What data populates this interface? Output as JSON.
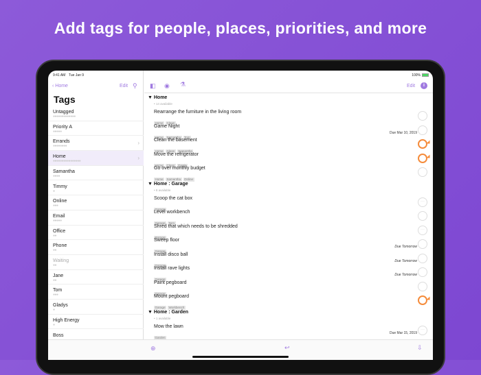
{
  "headline": "Add tags for people, places, priorities, and more",
  "status": {
    "time": "9:41 AM",
    "date": "Tue Jan 9",
    "battery": "100%"
  },
  "sidebar": {
    "back": "Home",
    "edit": "Edit",
    "title": "Tags",
    "items": [
      {
        "label": "Untagged",
        "dots": "●●●●●●●●●●●●●",
        "chev": false
      },
      {
        "label": "Priority A",
        "dots": "●●●●●",
        "chev": false
      },
      {
        "label": "Errands",
        "dots": "●●●●●●●●",
        "chev": true
      },
      {
        "label": "Home",
        "dots": "●●●●●●●●●●●●●●●●",
        "chev": true,
        "selected": true
      },
      {
        "label": "Samantha",
        "dots": "●●●●",
        "chev": false
      },
      {
        "label": "Timmy",
        "dots": "●",
        "chev": false
      },
      {
        "label": "Online",
        "dots": "●●●",
        "chev": false
      },
      {
        "label": "Email",
        "dots": "●●●●●",
        "chev": false
      },
      {
        "label": "Office",
        "dots": "●●",
        "chev": false
      },
      {
        "label": "Phone",
        "dots": "●●",
        "chev": false
      },
      {
        "label": "Waiting",
        "dots": "●●",
        "chev": false,
        "muted": true
      },
      {
        "label": "Jane",
        "dots": "●●",
        "chev": false
      },
      {
        "label": "Tom",
        "dots": "●●●",
        "chev": false
      },
      {
        "label": "Gladys",
        "dots": "●",
        "chev": false
      },
      {
        "label": "High Energy",
        "dots": "●",
        "chev": false
      },
      {
        "label": "Boss",
        "dots": "",
        "chev": false
      }
    ]
  },
  "detail": {
    "edit": "Edit",
    "groups": [
      {
        "title": "Home",
        "sub": "• 14 available",
        "tasks": [
          {
            "title": "Rearrange the furniture in the living room",
            "tags": [
              "Home",
              "Clean"
            ],
            "due": "",
            "state": "empty"
          },
          {
            "title": "Game Night",
            "tags": [
              "Home",
              "Samantha",
              "Tom"
            ],
            "due": "Due Mar 10, 2019",
            "state": "empty"
          },
          {
            "title": "Clean the basement",
            "tags": [
              "Home",
              "Clean",
              "Samantha"
            ],
            "due": "",
            "state": "flag"
          },
          {
            "title": "Move the refrigerator",
            "tags": [
              "Home",
              "Clean",
              "Darrin"
            ],
            "due": "",
            "state": "flag"
          },
          {
            "title": "Go over monthly budget",
            "tags": [
              "Home",
              "Samantha",
              "Online"
            ],
            "due": "",
            "state": "empty"
          }
        ]
      },
      {
        "title": "Home : Garage",
        "sub": "• 8 available",
        "tasks": [
          {
            "title": "Scoop the cat box",
            "tags": [
              "Garage"
            ],
            "due": "",
            "state": "dots"
          },
          {
            "title": "Level workbench",
            "tags": [
              "Garage",
              "Tom"
            ],
            "due": "",
            "state": "empty"
          },
          {
            "title": "Shred that which needs to be shredded",
            "tags": [
              "Garage"
            ],
            "due": "",
            "state": "dots"
          },
          {
            "title": "Sweep floor",
            "tags": [
              "Garage"
            ],
            "due": "Due Tomorrow",
            "italic": true,
            "state": "empty"
          },
          {
            "title": "Install disco ball",
            "tags": [
              "Garage"
            ],
            "due": "Due Tomorrow",
            "italic": true,
            "state": "empty"
          },
          {
            "title": "Install rave lights",
            "tags": [
              "Garage"
            ],
            "due": "Due Tomorrow",
            "italic": true,
            "state": "empty"
          },
          {
            "title": "Paint pegboard",
            "tags": [
              "Garage"
            ],
            "due": "",
            "state": "empty"
          },
          {
            "title": "Mount pegboard",
            "tags": [
              "Garage",
              "Workbench"
            ],
            "due": "",
            "state": "flag"
          }
        ]
      },
      {
        "title": "Home : Garden",
        "sub": "• 1 available",
        "tasks": [
          {
            "title": "Mow the lawn",
            "tags": [
              "Garden"
            ],
            "due": "Due Mar 15, 2019",
            "state": "dots"
          }
        ]
      }
    ]
  },
  "colors": {
    "accent": "#a07ae0",
    "flag": "#f58b3a",
    "background": "#8a55d8"
  }
}
